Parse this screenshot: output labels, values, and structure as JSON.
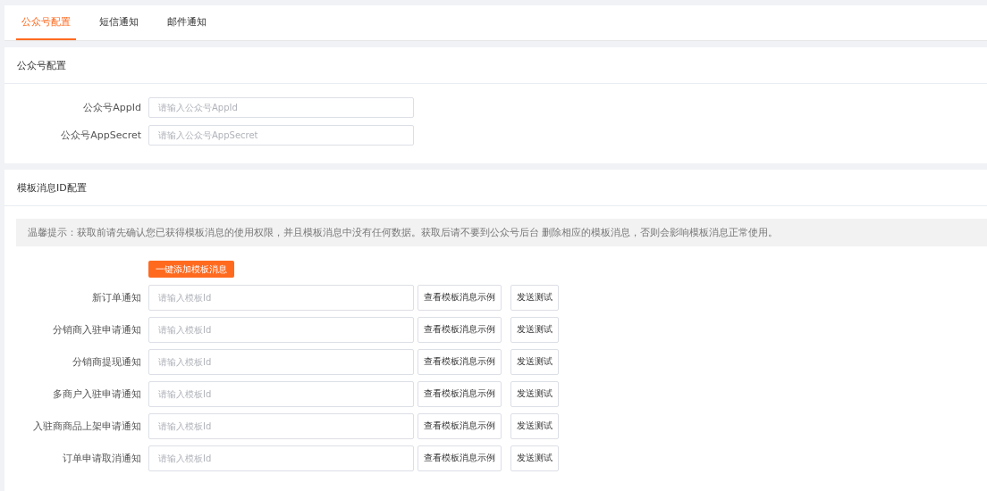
{
  "tabs": [
    {
      "label": "公众号配置",
      "selected": true
    },
    {
      "label": "短信通知",
      "selected": false
    },
    {
      "label": "邮件通知",
      "selected": false
    }
  ],
  "account_section": {
    "title": "公众号配置",
    "fields": [
      {
        "label": "公众号AppId",
        "placeholder": "请输入公众号AppId"
      },
      {
        "label": "公众号AppSecret",
        "placeholder": "请输入公众号AppSecret"
      }
    ]
  },
  "template_section": {
    "title": "模板消息ID配置",
    "notice": "温馨提示：获取前请先确认您已获得模板消息的使用权限，并且模板消息中没有任何数据。获取后请不要到公众号后台 删除相应的模板消息，否则会影响模板消息正常使用。",
    "add_button": "一键添加模板消息",
    "rows": [
      {
        "label": "新订单通知",
        "placeholder": "请输入模板Id",
        "example_button": "查看模板消息示例",
        "test_button": "发送测试"
      },
      {
        "label": "分销商入驻申请通知",
        "placeholder": "请输入模板Id",
        "example_button": "查看模板消息示例",
        "test_button": "发送测试"
      },
      {
        "label": "分销商提现通知",
        "placeholder": "请输入模板Id",
        "example_button": "查看模板消息示例",
        "test_button": "发送测试"
      },
      {
        "label": "多商户入驻申请通知",
        "placeholder": "请输入模板Id",
        "example_button": "查看模板消息示例",
        "test_button": "发送测试"
      },
      {
        "label": "入驻商商品上架申请通知",
        "placeholder": "请输入模板Id",
        "example_button": "查看模板消息示例",
        "test_button": "发送测试"
      },
      {
        "label": "订单申请取消通知",
        "placeholder": "请输入模板Id",
        "example_button": "查看模板消息示例",
        "test_button": "发送测试"
      }
    ]
  }
}
